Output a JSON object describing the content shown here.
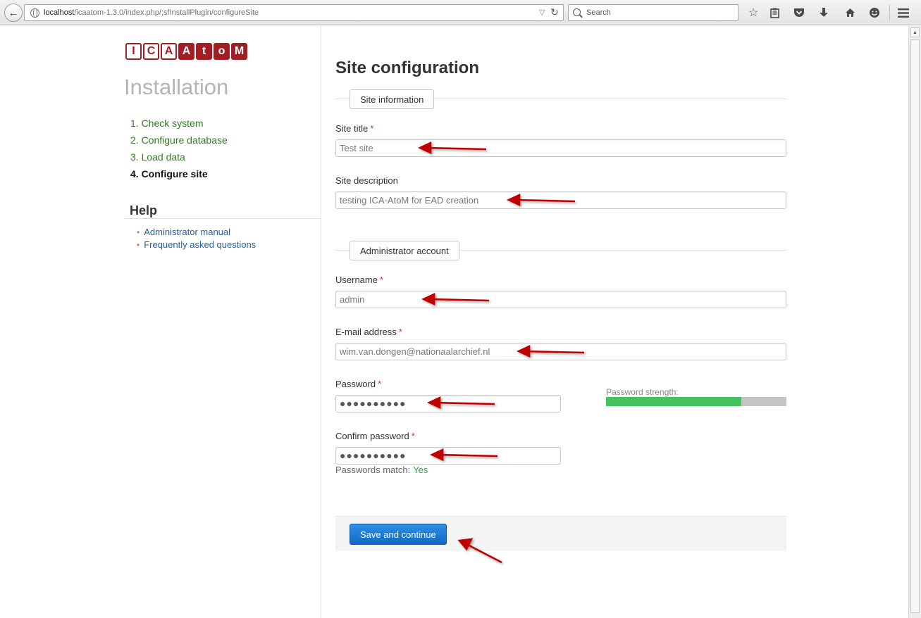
{
  "browser": {
    "url_host": "localhost",
    "url_path": "/icaatom-1.3.0/index.php/;sfInstallPlugin/configureSite",
    "search_placeholder": "Search"
  },
  "logo": {
    "letters": [
      "I",
      "C",
      "A",
      "A",
      "t",
      "o",
      "M"
    ],
    "brand_color": "#a31e24"
  },
  "sidebar": {
    "title": "Installation",
    "steps": [
      {
        "label": "1. Check system"
      },
      {
        "label": "2. Configure database"
      },
      {
        "label": "3. Load data"
      },
      {
        "label": "4. Configure site"
      }
    ],
    "current_step": 4,
    "help_title": "Help",
    "help_links": [
      {
        "label": "Administrator manual"
      },
      {
        "label": "Frequently asked questions"
      }
    ]
  },
  "main": {
    "title": "Site configuration",
    "site_section": "Site information",
    "site_title_label": "Site title",
    "site_title_value": "Test site",
    "site_description_label": "Site description",
    "site_description_value": "testing ICA-AtoM for EAD creation",
    "admin_section": "Administrator account",
    "username_label": "Username",
    "username_value": "admin",
    "email_label": "E-mail address",
    "email_value": "wim.van.dongen@nationaalarchief.nl",
    "password_label": "Password",
    "password_value": "●●●●●●●●●●",
    "password_strength_label": "Password strength:",
    "password_strength": 0.75,
    "confirm_label": "Confirm password",
    "confirm_value": "●●●●●●●●●●",
    "match_label": "Passwords match:",
    "match_value": "Yes",
    "required_marker": "*",
    "save_label": "Save and continue"
  },
  "colors": {
    "step_link": "#2e7d1f",
    "help_link": "#1d62a4",
    "strength_fill": "#42c35e",
    "arrow": "#c00000",
    "button": "#1a73d0"
  }
}
